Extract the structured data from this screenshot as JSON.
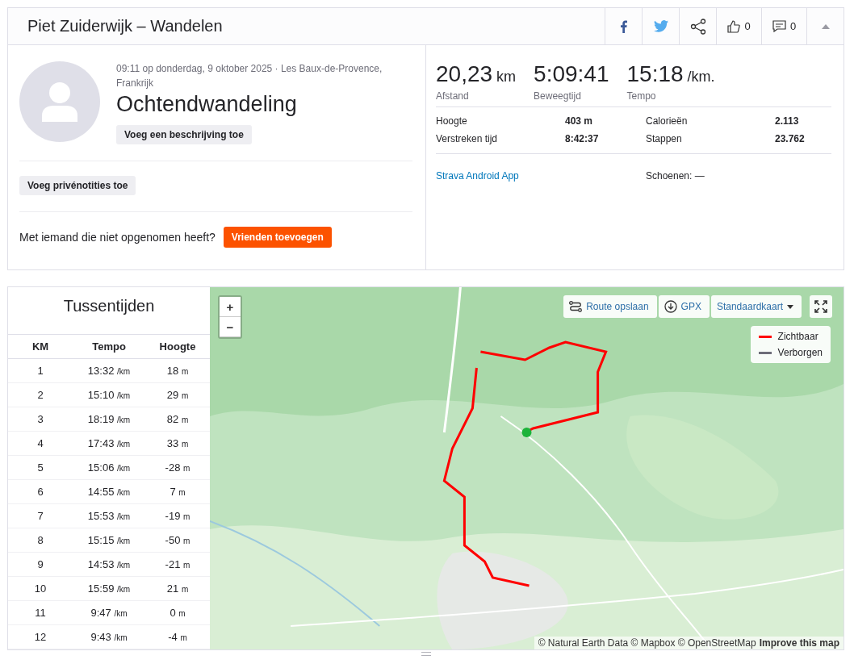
{
  "header": {
    "title": "Piet Zuiderwijk – Wandelen",
    "likes": "0",
    "comments": "0"
  },
  "activity": {
    "meta": "09:11 op donderdag, 9 oktober 2025 · Les Baux-de-Provence, Frankrijk",
    "title": "Ochtendwandeling",
    "description_button": "Voeg een beschrijving toe",
    "notes_button": "Voeg privénotities toe",
    "invite_text": "Met iemand die niet opgenomen heeft?",
    "invite_button": "Vrienden toevoegen"
  },
  "stats": {
    "primary": [
      {
        "value": "20,23",
        "unit": "km",
        "label": "Afstand"
      },
      {
        "value": "5:09:41",
        "label": "Beweegtijd"
      },
      {
        "value": "15:18",
        "unit": "/km.",
        "label": "Tempo"
      }
    ],
    "secondary": [
      {
        "label": "Hoogte",
        "value": "403 m"
      },
      {
        "label": "Calorieën",
        "value": "2.113"
      },
      {
        "label": "Verstreken tijd",
        "value": "8:42:37"
      },
      {
        "label": "Stappen",
        "value": "23.762"
      }
    ],
    "device": "Strava Android App",
    "shoes": "Schoenen: —"
  },
  "splits": {
    "title": "Tussentijden",
    "columns": [
      "KM",
      "Tempo",
      "Hoogte"
    ],
    "rows": [
      {
        "km": "1",
        "pace": "13:32",
        "pace_unit": "/km",
        "elev": "18",
        "elev_unit": "m"
      },
      {
        "km": "2",
        "pace": "15:10",
        "pace_unit": "/km",
        "elev": "29",
        "elev_unit": "m"
      },
      {
        "km": "3",
        "pace": "18:19",
        "pace_unit": "/km",
        "elev": "82",
        "elev_unit": "m"
      },
      {
        "km": "4",
        "pace": "17:43",
        "pace_unit": "/km",
        "elev": "33",
        "elev_unit": "m"
      },
      {
        "km": "5",
        "pace": "15:06",
        "pace_unit": "/km",
        "elev": "-28",
        "elev_unit": "m"
      },
      {
        "km": "6",
        "pace": "14:55",
        "pace_unit": "/km",
        "elev": "7",
        "elev_unit": "m"
      },
      {
        "km": "7",
        "pace": "15:53",
        "pace_unit": "/km",
        "elev": "-19",
        "elev_unit": "m"
      },
      {
        "km": "8",
        "pace": "15:15",
        "pace_unit": "/km",
        "elev": "-50",
        "elev_unit": "m"
      },
      {
        "km": "9",
        "pace": "14:53",
        "pace_unit": "/km",
        "elev": "-21",
        "elev_unit": "m"
      },
      {
        "km": "10",
        "pace": "15:59",
        "pace_unit": "/km",
        "elev": "21",
        "elev_unit": "m"
      },
      {
        "km": "11",
        "pace": "9:47",
        "pace_unit": "/km",
        "elev": "0",
        "elev_unit": "m"
      },
      {
        "km": "12",
        "pace": "9:43",
        "pace_unit": "/km",
        "elev": "-4",
        "elev_unit": "m"
      }
    ]
  },
  "map": {
    "kind": "picture",
    "zoom_in": "+",
    "zoom_out": "−",
    "save_route": "Route opslaan",
    "gpx": "GPX",
    "style": "Standaardkaart",
    "legend": [
      {
        "label": "Zichtbaar",
        "color": "#ff0000"
      },
      {
        "label": "Verborgen",
        "color": "#6d6d78"
      }
    ],
    "attribution": "© Natural Earth Data © Mapbox © OpenStreetMap",
    "improve": "Improve this map"
  }
}
